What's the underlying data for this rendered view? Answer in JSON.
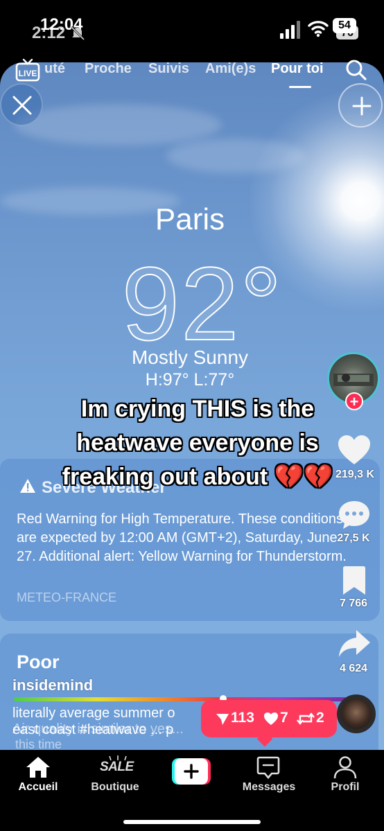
{
  "status_bar": {
    "time": "12:04",
    "time_behind": "2:12",
    "battery_front": "54",
    "battery_back": "76"
  },
  "top_nav": {
    "live_label": "LIVE",
    "tabs": [
      {
        "label": "uté",
        "active": false
      },
      {
        "label": "Proche",
        "active": false
      },
      {
        "label": "Suivis",
        "active": false
      },
      {
        "label": "Ami(e)s",
        "active": false
      },
      {
        "label": "Pour toi",
        "active": true
      }
    ]
  },
  "weather": {
    "city": "Paris",
    "temperature": "92°",
    "condition": "Mostly Sunny",
    "hilo": "H:97°  L:77°",
    "alert": {
      "title": "Severe Weather",
      "body": "Red Warning for High Temperature. These conditions are expected by 12:00 AM (GMT+2), Saturday, June 27. Additional alert: Yellow Warning for Thunderstorm.",
      "source": "METEO-FRANCE"
    },
    "air_quality": {
      "title": "Poor",
      "level_fraction": 0.63,
      "hidden_line": "Air quality is similar to yes..."
    }
  },
  "caption": {
    "line1": "Im crying THIS is the",
    "line2": "heatwave everyone is",
    "line3": "freaking out about 💔💔"
  },
  "side_actions": {
    "likes": "219,3 K",
    "comments": "27,5 K",
    "bookmarks": "7 766",
    "shares": "4 624"
  },
  "post": {
    "username": "insidemind",
    "description_line1": "literally average summer o",
    "description_line2": "east coast #heatwave ... p",
    "description_line3": "this time"
  },
  "engagement_popup": {
    "views": "113",
    "likes": "7",
    "reposts": "2"
  },
  "bottom_nav": {
    "home": "Accueil",
    "shop": "Boutique",
    "shop_badge": "SALE",
    "messages": "Messages",
    "profile": "Profil"
  },
  "colors": {
    "accent_red": "#fe2c55",
    "popup_pink": "#fe3a5c",
    "avatar_ring": "#4dc2d4",
    "sky_blue": "#79a6d9"
  }
}
